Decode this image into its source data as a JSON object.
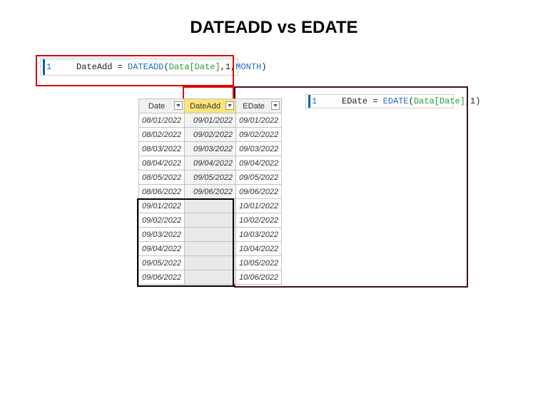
{
  "title": "DATEADD vs EDATE",
  "formula1": {
    "line_no": "1",
    "prefix": "DateAdd = ",
    "fn": "DATEADD",
    "open": "(",
    "colref": "Data[Date]",
    "mid": ",1,",
    "interval": "MONTH",
    "close": ")"
  },
  "formula2": {
    "line_no": "1",
    "prefix": "EDate = ",
    "fn": "EDATE",
    "open": "(",
    "colref": "Data[Date]",
    "mid": ",1",
    "close": ")"
  },
  "headers": {
    "date": "Date",
    "dateadd": "DateAdd",
    "edate": "EDate"
  },
  "rows": [
    {
      "date": "08/01/2022",
      "dateadd": "09/01/2022",
      "edate": "09/01/2022"
    },
    {
      "date": "08/02/2022",
      "dateadd": "09/02/2022",
      "edate": "09/02/2022"
    },
    {
      "date": "08/03/2022",
      "dateadd": "09/03/2022",
      "edate": "09/03/2022"
    },
    {
      "date": "08/04/2022",
      "dateadd": "09/04/2022",
      "edate": "09/04/2022"
    },
    {
      "date": "08/05/2022",
      "dateadd": "09/05/2022",
      "edate": "09/05/2022"
    },
    {
      "date": "08/06/2022",
      "dateadd": "09/06/2022",
      "edate": "09/06/2022"
    },
    {
      "date": "09/01/2022",
      "dateadd": "",
      "edate": "10/01/2022"
    },
    {
      "date": "09/02/2022",
      "dateadd": "",
      "edate": "10/02/2022"
    },
    {
      "date": "09/03/2022",
      "dateadd": "",
      "edate": "10/03/2022"
    },
    {
      "date": "09/04/2022",
      "dateadd": "",
      "edate": "10/04/2022"
    },
    {
      "date": "09/05/2022",
      "dateadd": "",
      "edate": "10/05/2022"
    },
    {
      "date": "09/06/2022",
      "dateadd": "",
      "edate": "10/06/2022"
    }
  ],
  "chart_data": {
    "type": "table",
    "title": "DATEADD vs EDATE",
    "columns": [
      "Date",
      "DateAdd",
      "EDate"
    ],
    "rows": [
      [
        "08/01/2022",
        "09/01/2022",
        "09/01/2022"
      ],
      [
        "08/02/2022",
        "09/02/2022",
        "09/02/2022"
      ],
      [
        "08/03/2022",
        "09/03/2022",
        "09/03/2022"
      ],
      [
        "08/04/2022",
        "09/04/2022",
        "09/04/2022"
      ],
      [
        "08/05/2022",
        "09/05/2022",
        "09/05/2022"
      ],
      [
        "08/06/2022",
        "09/06/2022",
        "09/06/2022"
      ],
      [
        "09/01/2022",
        null,
        "10/01/2022"
      ],
      [
        "09/02/2022",
        null,
        "10/02/2022"
      ],
      [
        "09/03/2022",
        null,
        "10/03/2022"
      ],
      [
        "09/04/2022",
        null,
        "10/04/2022"
      ],
      [
        "09/05/2022",
        null,
        "10/05/2022"
      ],
      [
        "09/06/2022",
        null,
        "10/06/2022"
      ]
    ]
  }
}
